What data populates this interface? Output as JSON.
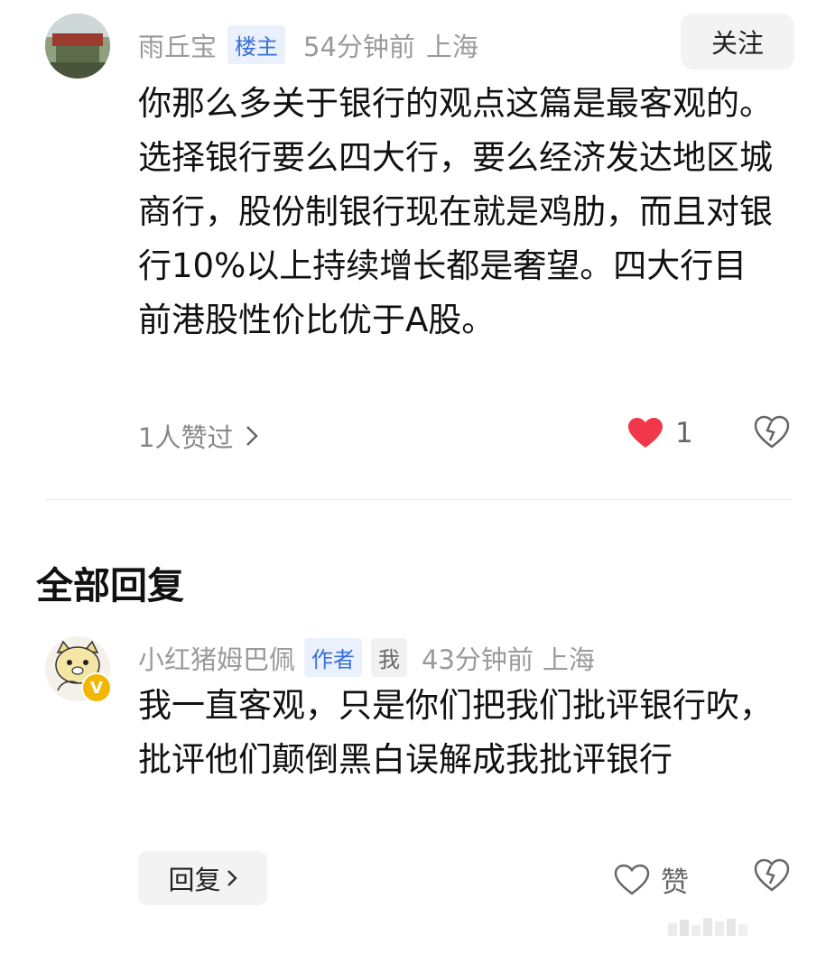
{
  "comment": {
    "username": "雨丘宝",
    "badge": "楼主",
    "time": "54分钟前",
    "location": "上海",
    "follow_label": "关注",
    "text": "你那么多关于银行的观点这篇是最客观的。选择银行要么四大行，要么经济发达地区城商行，股份制银行现在就是鸡肋，而且对银行10%以上持续增长都是奢望。四大行目前港股性价比优于A股。",
    "likers": "1人赞过",
    "like_count": "1"
  },
  "replies": {
    "title": "全部回复",
    "items": [
      {
        "username": "小红猪姆巴佩",
        "badge_author": "作者",
        "badge_me": "我",
        "time": "43分钟前",
        "location": "上海",
        "text": "我一直客观，只是你们把我们批评银行吹，批评他们颠倒黑白误解成我批评银行",
        "reply_label": "回复",
        "like_label": "赞"
      }
    ]
  },
  "colors": {
    "like_red": "#f0384a",
    "tag_blue": "#3a6fd8",
    "tag_bg": "#eaf1fd"
  }
}
